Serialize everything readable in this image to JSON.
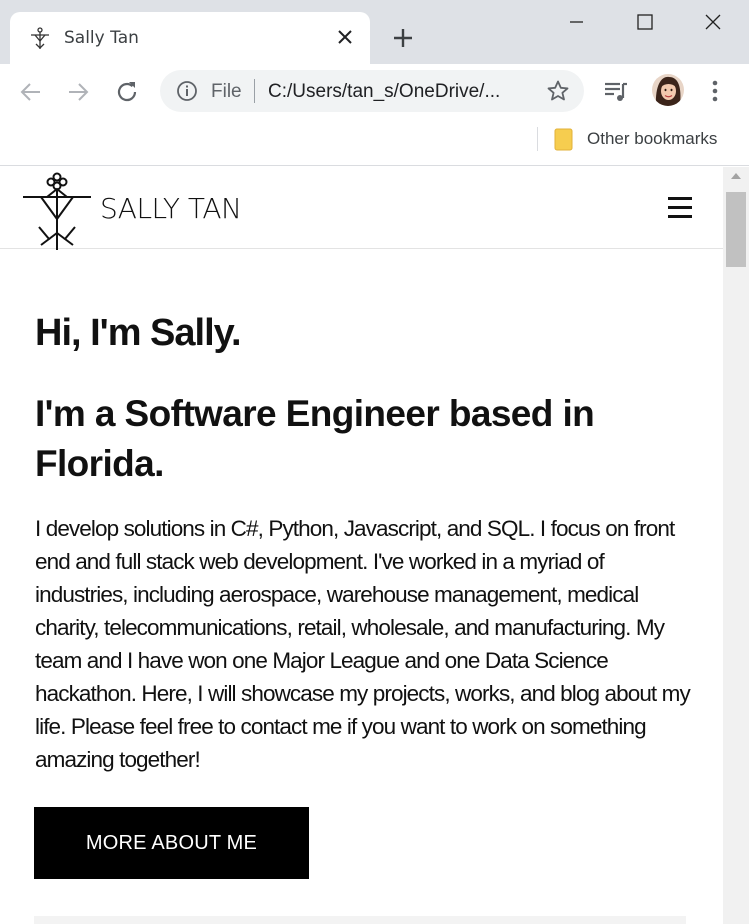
{
  "browser": {
    "tab": {
      "title": "Sally Tan"
    },
    "omnibox": {
      "scheme": "File",
      "url": "C:/Users/tan_s/OneDrive/..."
    },
    "bookmarks": {
      "other_label": "Other bookmarks"
    }
  },
  "site": {
    "name": "SALLY TAN",
    "hero": {
      "greeting": "Hi, I'm Sally.",
      "tagline": "I'm a Software Engineer based in Florida.",
      "bio": "I develop solutions in C#, Python, Javascript, and SQL. I focus on front end and full stack web development. I've worked in a myriad of industries, including aerospace, warehouse management, medical charity, telecommunications, retail, wholesale, and manufacturing. My team and I have won one Major League and one Data Science hackathon. Here, I will showcase my projects, works, and blog about my life. Please feel free to contact me if you want to work on something amazing together!",
      "cta_label": "MORE ABOUT ME"
    }
  },
  "icons": [
    "logo-icon",
    "tab-favicon-icon",
    "close-icon",
    "plus-icon",
    "minimize-icon",
    "maximize-icon",
    "window-close-icon",
    "back-arrow-icon",
    "forward-arrow-icon",
    "reload-icon",
    "info-icon",
    "star-icon",
    "media-queue-icon",
    "kebab-menu-icon",
    "folder-icon",
    "hamburger-menu-icon"
  ],
  "colors": {
    "chrome_bg": "#dee1e6",
    "omnibox_bg": "#f1f3f4",
    "cta_bg": "#000000",
    "text": "#111111"
  }
}
